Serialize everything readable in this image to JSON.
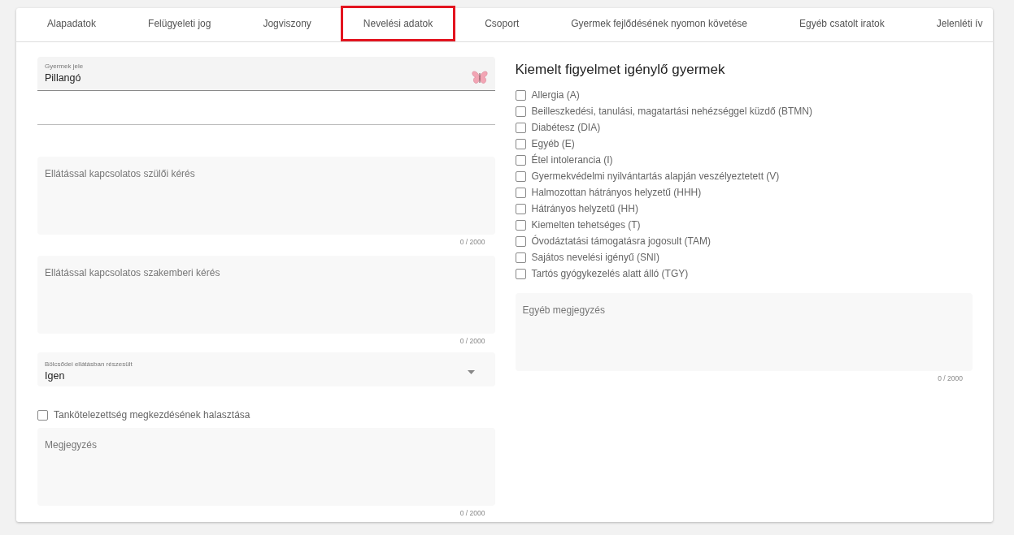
{
  "tabs": [
    {
      "label": "Alapadatok",
      "highlighted": false
    },
    {
      "label": "Felügyeleti jog",
      "highlighted": false
    },
    {
      "label": "Jogviszony",
      "highlighted": false
    },
    {
      "label": "Nevelési adatok",
      "highlighted": true
    },
    {
      "label": "Csoport",
      "highlighted": false
    },
    {
      "label": "Gyermek fejlődésének nyomon követése",
      "highlighted": false
    },
    {
      "label": "Egyéb csatolt iratok",
      "highlighted": false
    },
    {
      "label": "Jelenléti ív",
      "highlighted": false
    }
  ],
  "left": {
    "child_sign": {
      "label": "Gyermek jele",
      "value": "Pillangó"
    },
    "parent_request": {
      "placeholder": "Ellátással kapcsolatos szülői kérés",
      "counter": "0 / 2000"
    },
    "expert_request": {
      "placeholder": "Ellátással kapcsolatos szakemberi kérés",
      "counter": "0 / 2000"
    },
    "nursery_select": {
      "label": "Bölcsődei ellátásban részesült",
      "value": "Igen"
    },
    "postpone_checkbox": {
      "label": "Tankötelezettség megkezdésének halasztása",
      "checked": false
    },
    "note": {
      "placeholder": "Megjegyzés",
      "counter": "0 / 2000"
    }
  },
  "right": {
    "title": "Kiemelt figyelmet igénylő gyermek",
    "checkboxes": [
      {
        "label": "Allergia (A)",
        "checked": false
      },
      {
        "label": "Beilleszkedési, tanulási, magatartási nehézséggel küzdő (BTMN)",
        "checked": false
      },
      {
        "label": "Diabétesz (DIA)",
        "checked": false
      },
      {
        "label": "Egyéb (E)",
        "checked": false
      },
      {
        "label": "Étel intolerancia (I)",
        "checked": false
      },
      {
        "label": "Gyermekvédelmi nyilvántartás alapján veszélyeztetett (V)",
        "checked": false
      },
      {
        "label": "Halmozottan hátrányos helyzetű (HHH)",
        "checked": false
      },
      {
        "label": "Hátrányos helyzetű (HH)",
        "checked": false
      },
      {
        "label": "Kiemelten tehetséges (T)",
        "checked": false
      },
      {
        "label": "Óvodáztatási támogatásra jogosult (TAM)",
        "checked": false
      },
      {
        "label": "Sajátos nevelési igényű (SNI)",
        "checked": false
      },
      {
        "label": "Tartós gyógykezelés alatt álló (TGY)",
        "checked": false
      }
    ],
    "other_note": {
      "placeholder": "Egyéb megjegyzés",
      "counter": "0 / 2000"
    }
  }
}
